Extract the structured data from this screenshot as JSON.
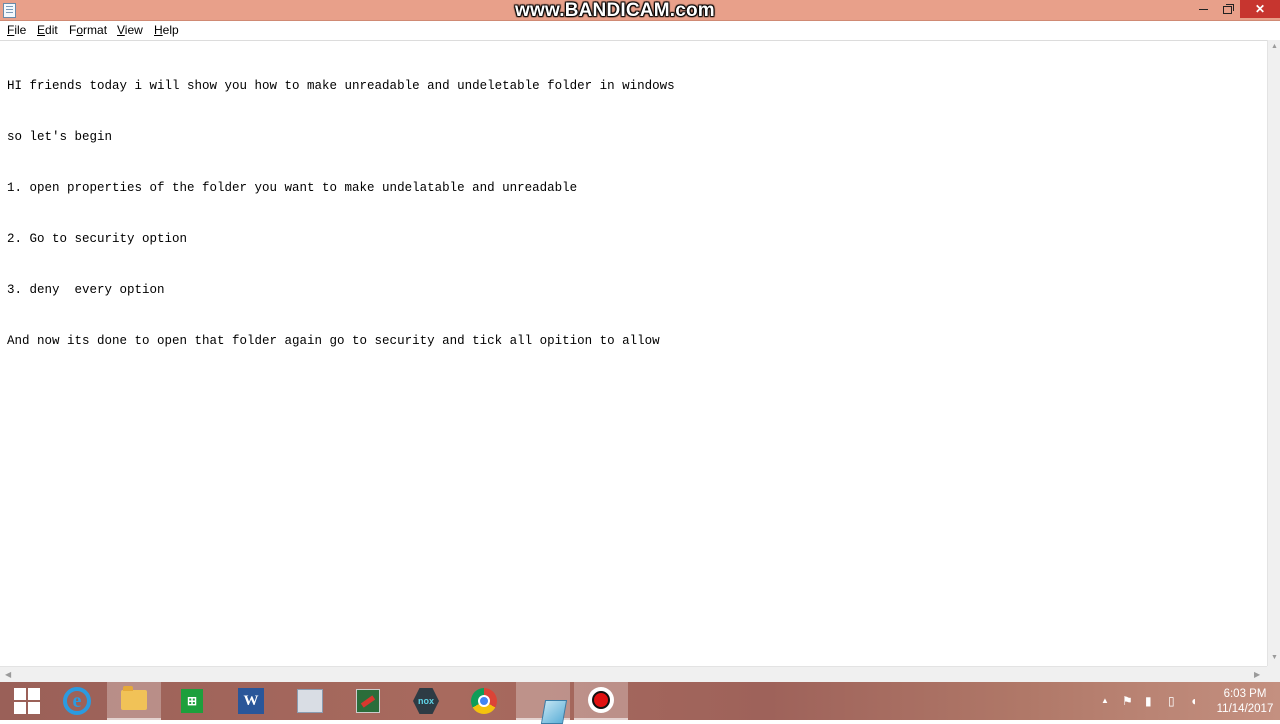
{
  "titlebar": {
    "watermark": "www.BANDICAM.com",
    "buttons": {
      "minimize": "minimize",
      "restore": "restore",
      "close": "✕"
    }
  },
  "menu": {
    "file": {
      "acc": "F",
      "rest": "ile"
    },
    "edit": {
      "acc": "E",
      "rest": "dit"
    },
    "format": {
      "pre": "F",
      "acc": "o",
      "rest": "rmat"
    },
    "view": {
      "acc": "V",
      "rest": "iew"
    },
    "help": {
      "acc": "H",
      "rest": "elp"
    }
  },
  "editor": {
    "lines": [
      "HI friends today i will show you how to make unreadable and undeletable folder in windows",
      "so let's begin",
      "1. open properties of the folder you want to make undelatable and unreadable",
      "2. Go to security option",
      "3. deny  every option",
      "And now its done to open that folder again go to security and tick all opition to allow"
    ]
  },
  "taskbar": {
    "apps": [
      {
        "name": "start",
        "icon": "windows-logo-icon"
      },
      {
        "name": "internet-explorer",
        "icon": "ie-icon",
        "glyph": "e"
      },
      {
        "name": "file-explorer",
        "icon": "folder-icon",
        "active": true
      },
      {
        "name": "store",
        "icon": "store-icon",
        "glyph": "⊞"
      },
      {
        "name": "word",
        "icon": "word-icon",
        "glyph": "W"
      },
      {
        "name": "monitor",
        "icon": "chart-icon"
      },
      {
        "name": "game",
        "icon": "game-icon"
      },
      {
        "name": "nox",
        "icon": "nox-icon",
        "glyph": "nox"
      },
      {
        "name": "chrome",
        "icon": "chrome-icon"
      },
      {
        "name": "notepad",
        "icon": "notepad-icon",
        "active": true
      },
      {
        "name": "bandicam",
        "icon": "record-icon",
        "active": true
      }
    ],
    "tray": {
      "icons": [
        "chevron-up-icon",
        "flag-icon",
        "network-icon",
        "power-icon",
        "volume-icon"
      ],
      "time": "6:03 PM",
      "date": "11/14/2017"
    }
  }
}
